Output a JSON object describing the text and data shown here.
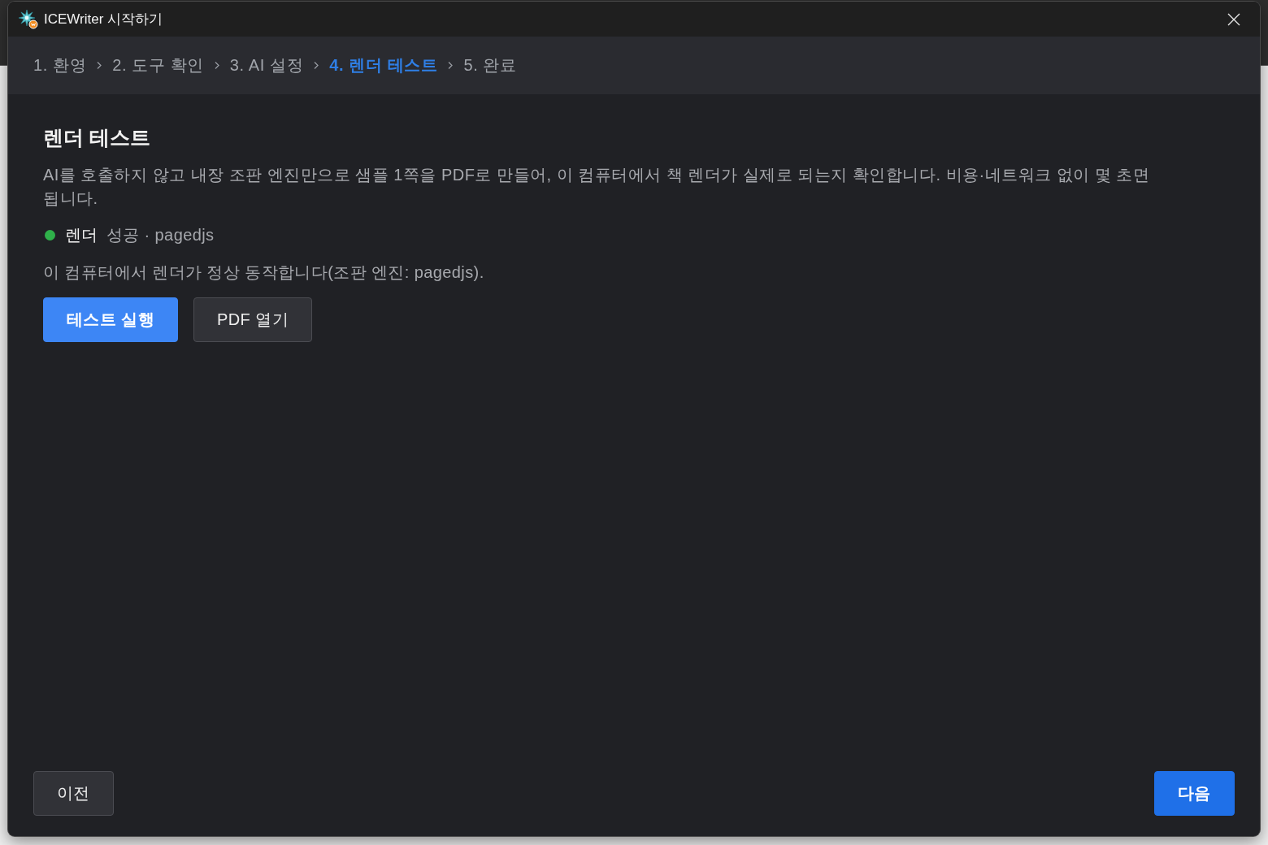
{
  "window": {
    "title": "ICEWriter 시작하기"
  },
  "steps": [
    {
      "label": "1. 환영",
      "selected": false
    },
    {
      "label": "2. 도구 확인",
      "selected": false
    },
    {
      "label": "3. AI 설정",
      "selected": false
    },
    {
      "label": "4. 렌더 테스트",
      "selected": true
    },
    {
      "label": "5. 완료",
      "selected": false
    }
  ],
  "section": {
    "title": "렌더 테스트",
    "description": "AI를 호출하지 않고 내장 조판 엔진만으로 샘플 1쪽을 PDF로 만들어, 이 컴퓨터에서 책 렌더가 실제로 되는지 확인합니다. 비용·네트워크 없이 몇 초면 됩니다.",
    "status": {
      "success": true,
      "label": "렌더",
      "detail": "성공 · pagedjs"
    },
    "message": "이 컴퓨터에서 렌더가 정상 동작합니다(조판 엔진: pagedjs).",
    "actions": [
      {
        "label": "테스트 실행",
        "kind": "primary"
      },
      {
        "label": "PDF 열기",
        "kind": "secondary"
      }
    ]
  },
  "footer": {
    "buttons": [
      {
        "label": "이전",
        "kind": "secondary"
      },
      {
        "label": "다음",
        "kind": "next"
      }
    ]
  }
}
